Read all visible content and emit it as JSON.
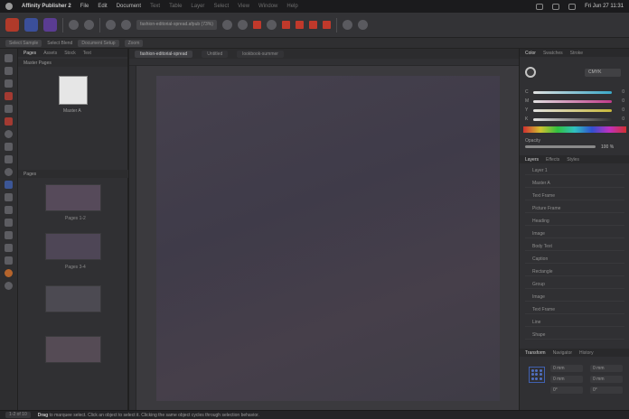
{
  "menubar": {
    "app_name": "Affinity Publisher 2",
    "items": [
      "File",
      "Edit",
      "Document",
      "Text",
      "Table",
      "Layer",
      "Select",
      "View",
      "Window",
      "Help"
    ],
    "clock": "Fri Jun 27  11:31"
  },
  "toolbar": {
    "filename": "fashion-editorial-spread.afpub (73%)"
  },
  "context_bar": {
    "items": [
      "Select Sample",
      "Select Blend",
      "Document Setup",
      "Zoom"
    ]
  },
  "pages_panel": {
    "tabs": [
      "Pages",
      "Assets",
      "Stock",
      "Text"
    ],
    "master_section": "Master Pages",
    "master_label": "Master A",
    "pages_section": "Pages",
    "page_labels": [
      "Pages 1-2",
      "Pages 3-4"
    ]
  },
  "canvas": {
    "tabs": [
      "fashion-editorial-spread",
      "Untitled",
      "lookbook-summer"
    ]
  },
  "color_panel": {
    "tabs": [
      "Color",
      "Swatches",
      "Stroke"
    ],
    "model": "CMYK",
    "sliders": [
      {
        "label": "C",
        "value": "0",
        "color": "#3aa8c8"
      },
      {
        "label": "M",
        "value": "0",
        "color": "#c03a8a"
      },
      {
        "label": "Y",
        "value": "0",
        "color": "#c8b83a"
      },
      {
        "label": "K",
        "value": "0",
        "color": "#555555"
      }
    ],
    "opacity_label": "Opacity",
    "opacity_value": "100 %"
  },
  "layers_panel": {
    "tabs": [
      "Layers",
      "Effects",
      "Styles"
    ],
    "rows": [
      "Layer 1",
      "Master A",
      "Text Frame",
      "Picture Frame",
      "Heading",
      "Image",
      "Body Text",
      "Caption",
      "Rectangle",
      "Group",
      "Image",
      "Text Frame",
      "Line",
      "Shape"
    ]
  },
  "transform_panel": {
    "tabs": [
      "Transform",
      "Navigator",
      "History"
    ],
    "fields": {
      "x": "0 mm",
      "y": "0 mm",
      "w": "0 mm",
      "h": "0 mm",
      "r": "0°",
      "s": "0°"
    }
  },
  "status_bar": {
    "page": "1-2 of 10",
    "hint_bold": "Drag",
    "hint_text": "to marquee select. Click an object to select it. Clicking the same object cycles through selection behavior."
  }
}
